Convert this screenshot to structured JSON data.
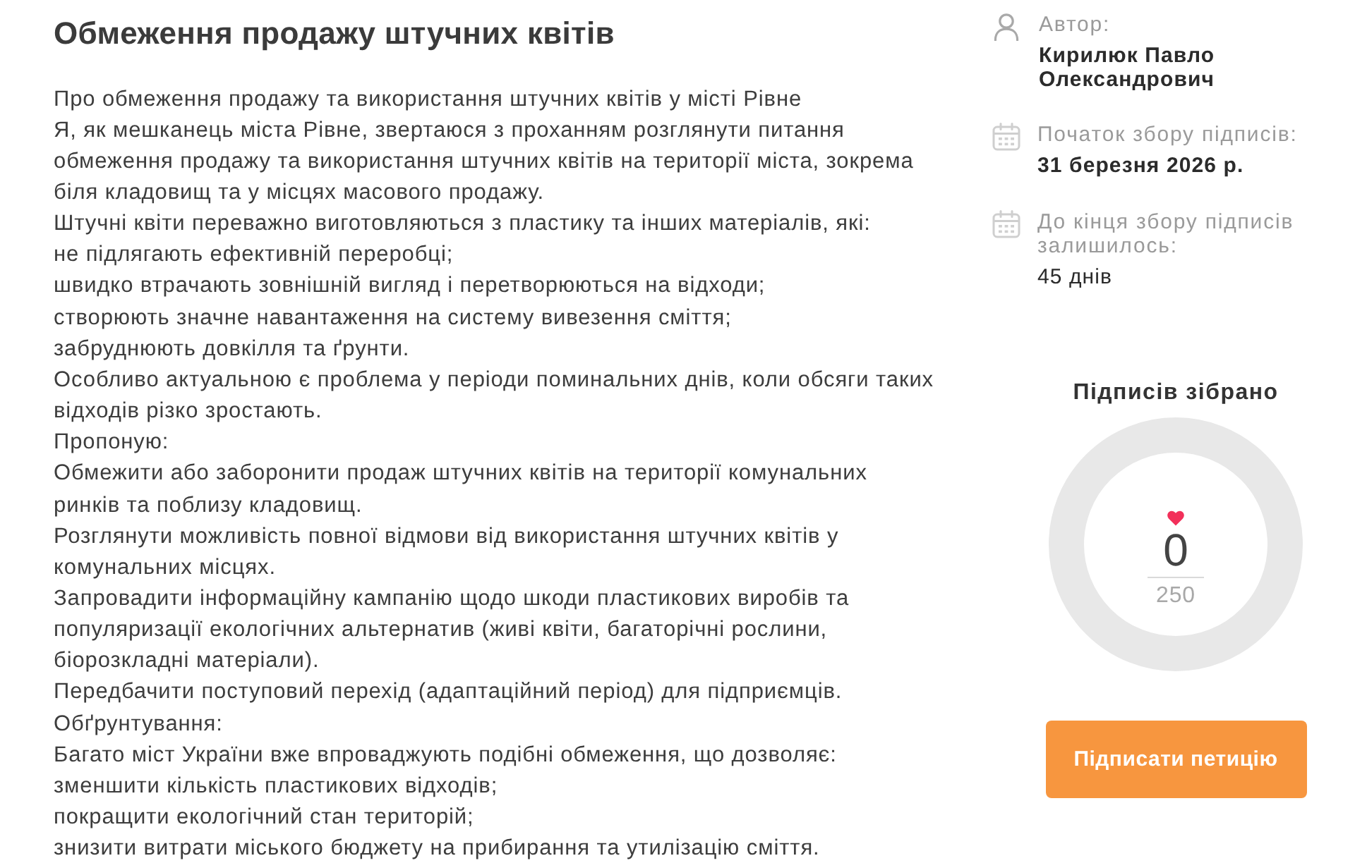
{
  "petition": {
    "title": "Обмеження продажу штучних квітів",
    "paragraphs": [
      "Про обмеження продажу та використання штучних квітів у місті Рівне",
      "Я, як мешканець міста Рівне, звертаюся з проханням розглянути питання обмеження продажу та використання штучних квітів на території міста, зокрема біля кладовищ та у місцях масового продажу.",
      "Штучні квіти переважно виготовляються з пластику та інших матеріалів, які:",
      "не підлягають ефективній переробці;",
      "швидко втрачають зовнішній вигляд і перетворюються на відходи;",
      "створюють значне навантаження на систему вивезення сміття;",
      "забруднюють довкілля та ґрунти.",
      "Особливо актуальною є проблема у періоди поминальних днів, коли обсяги таких відходів різко зростають.",
      "Пропоную:",
      "Обмежити або заборонити продаж штучних квітів на території комунальних ринків та поблизу кладовищ.",
      "Розглянути можливість повної відмови від використання штучних квітів у комунальних місцях.",
      "Запровадити інформаційну кампанію щодо шкоди пластикових виробів та популяризації екологічних альтернатив (живі квіти, багаторічні рослини, біорозкладні матеріали).",
      "Передбачити поступовий перехід (адаптаційний період) для підприємців.",
      "Обґрунтування:",
      "Багато міст України вже впроваджують подібні обмеження, що дозволяє:",
      "зменшити кількість пластикових відходів;",
      "покращити екологічний стан територій;",
      "знизити витрати міського бюджету на прибирання та утилізацію сміття."
    ]
  },
  "sidebar": {
    "details": [
      {
        "kind": "author",
        "label": "Автор:",
        "value": "Кирилюк Павло Олександрович"
      },
      {
        "kind": "start",
        "label": "Початок збору підписів:",
        "value": "31 березня 2026 р."
      },
      {
        "kind": "remaining",
        "label": "До кінця збору підписів залишилось:",
        "value": "45 днів"
      }
    ],
    "signatures": {
      "title": "Підписів зібрано",
      "count": "0",
      "goal": "250"
    },
    "sign_button": "Підписати петицію"
  }
}
